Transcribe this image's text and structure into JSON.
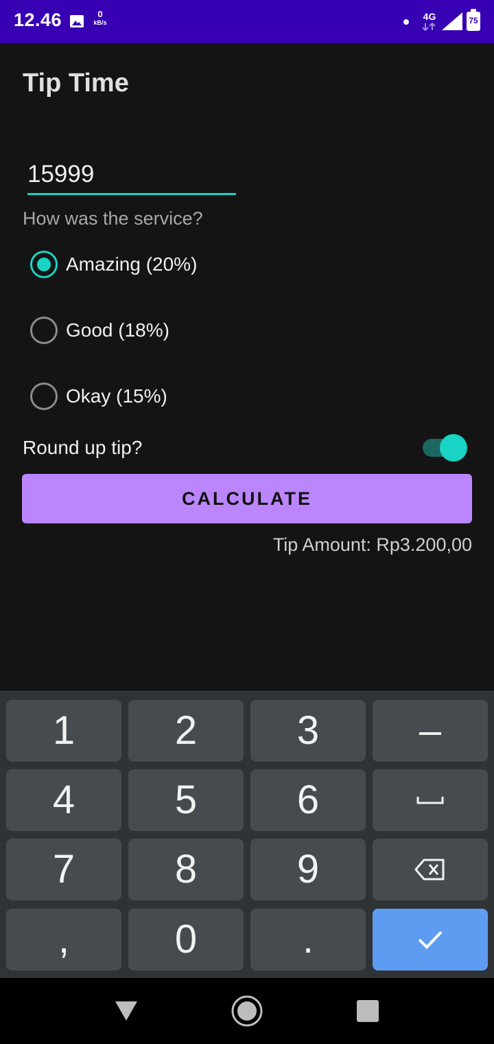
{
  "status_bar": {
    "time": "12.46",
    "speed_value": "0",
    "speed_unit": "kB/s",
    "network": "4G",
    "battery": "75"
  },
  "app": {
    "title": "Tip Time",
    "amount_value": "15999",
    "service_question": "How was the service?",
    "options": [
      {
        "label": "Amazing (20%)",
        "checked": true
      },
      {
        "label": "Good (18%)",
        "checked": false
      },
      {
        "label": "Okay (15%)",
        "checked": false
      }
    ],
    "round_up_label": "Round up tip?",
    "round_up_enabled": true,
    "calculate_label": "CALCULATE",
    "tip_result": "Tip Amount: Rp3.200,00"
  },
  "keyboard": {
    "rows": [
      [
        "1",
        "2",
        "3",
        "–"
      ],
      [
        "4",
        "5",
        "6",
        "space-icon"
      ],
      [
        "7",
        "8",
        "9",
        "backspace-icon"
      ],
      [
        ",",
        "0",
        ".",
        "check-icon"
      ]
    ]
  },
  "colors": {
    "status_bar": "#3700b3",
    "accent": "#19d3c5",
    "button": "#bb86fc",
    "keyboard_action": "#5e9cf2"
  }
}
